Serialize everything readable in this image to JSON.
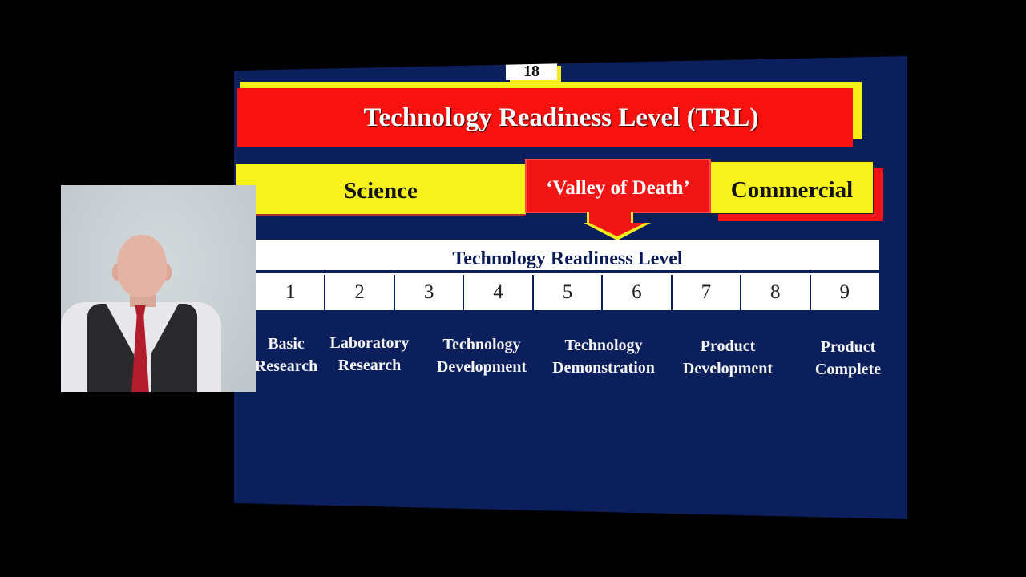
{
  "slide": {
    "page_number": "18",
    "title": "Technology Readiness Level (TRL)",
    "phases": {
      "science": "Science",
      "valley": "‘Valley of Death’",
      "commercial": "Commercial"
    },
    "scale": {
      "title": "Technology Readiness Level",
      "levels": [
        "1",
        "2",
        "3",
        "4",
        "5",
        "6",
        "7",
        "8",
        "9"
      ]
    },
    "stages": [
      {
        "line1": "Basic",
        "line2": "Research"
      },
      {
        "line1": "Laboratory",
        "line2": "Research"
      },
      {
        "line1": "Technology",
        "line2": "Development"
      },
      {
        "line1": "Technology",
        "line2": "Demonstration"
      },
      {
        "line1": "Product",
        "line2": "Development"
      },
      {
        "line1": "Product",
        "line2": "Complete"
      }
    ],
    "colors": {
      "background": "#0a1f5c",
      "red": "#f21515",
      "yellow": "#f7f21c",
      "white": "#ffffff"
    }
  },
  "presenter": {
    "label": "presenter-video"
  }
}
